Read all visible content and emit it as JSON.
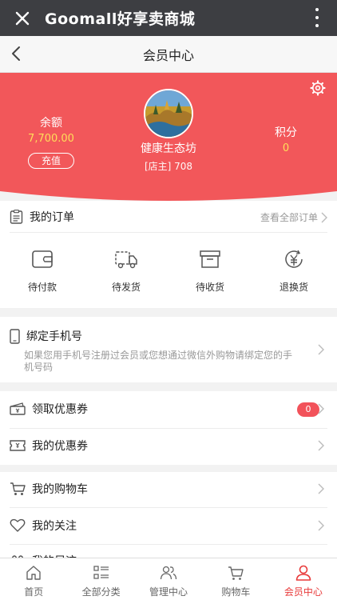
{
  "app": {
    "title": "Goomall好享卖商城"
  },
  "nav": {
    "title": "会员中心"
  },
  "profile": {
    "balance_label": "余额",
    "balance_value": "7,700.00",
    "recharge_label": "充值",
    "shop_name": "健康生态坊",
    "role": "[店主] 708",
    "points_label": "积分",
    "points_value": "0"
  },
  "orders": {
    "title": "我的订单",
    "view_all": "查看全部订单",
    "statuses": [
      {
        "label": "待付款",
        "icon": "wallet-icon"
      },
      {
        "label": "待发货",
        "icon": "truck-icon"
      },
      {
        "label": "待收货",
        "icon": "box-icon"
      },
      {
        "label": "退换货",
        "icon": "refund-icon"
      }
    ]
  },
  "bind_phone": {
    "title": "绑定手机号",
    "desc": "如果您用手机号注册过会员或您想通过微信外购物请绑定您的手机号码"
  },
  "coupons": {
    "claim": "领取优惠券",
    "claim_badge": "0",
    "mine": "我的优惠券"
  },
  "menu": {
    "cart": "我的购物车",
    "follow": "我的关注",
    "footprint": "我的足迹"
  },
  "tabbar": [
    {
      "label": "首页",
      "icon": "home-icon"
    },
    {
      "label": "全部分类",
      "icon": "category-icon"
    },
    {
      "label": "管理中心",
      "icon": "users-icon"
    },
    {
      "label": "购物车",
      "icon": "cart-icon"
    },
    {
      "label": "会员中心",
      "icon": "person-icon",
      "active": true
    }
  ],
  "colors": {
    "hero": "#f2575a",
    "accent": "#e83a3a",
    "value": "#ffde59",
    "topbar": "#3d3e42"
  }
}
